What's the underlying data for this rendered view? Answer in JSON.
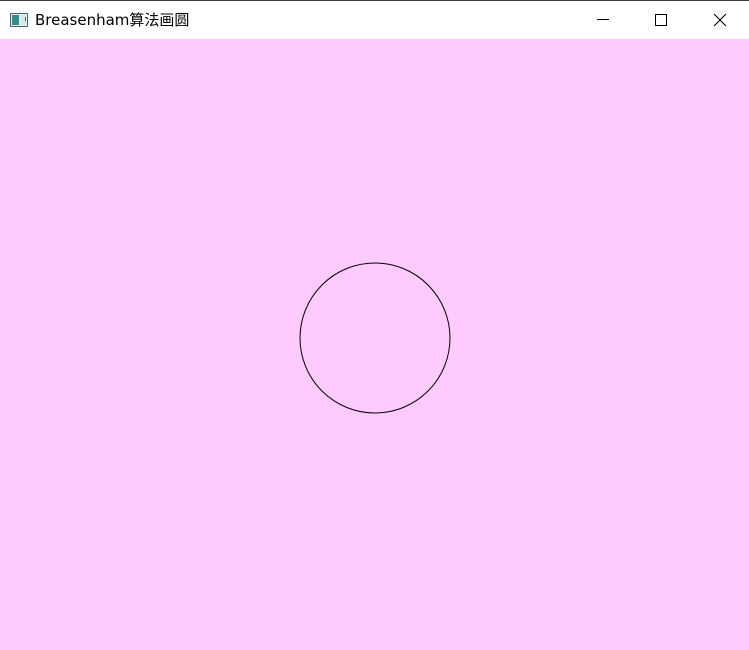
{
  "window": {
    "title": "Breasenham算法画圆",
    "background_color": "#ffcbff",
    "titlebar_color": "#ffffff"
  },
  "titlebar": {
    "app_icon": "window-app-icon",
    "controls": {
      "minimize_icon": "minimize-icon",
      "maximize_icon": "maximize-icon",
      "close_icon": "close-icon"
    }
  },
  "drawing": {
    "shape": "circle",
    "stroke_color": "#000000"
  }
}
